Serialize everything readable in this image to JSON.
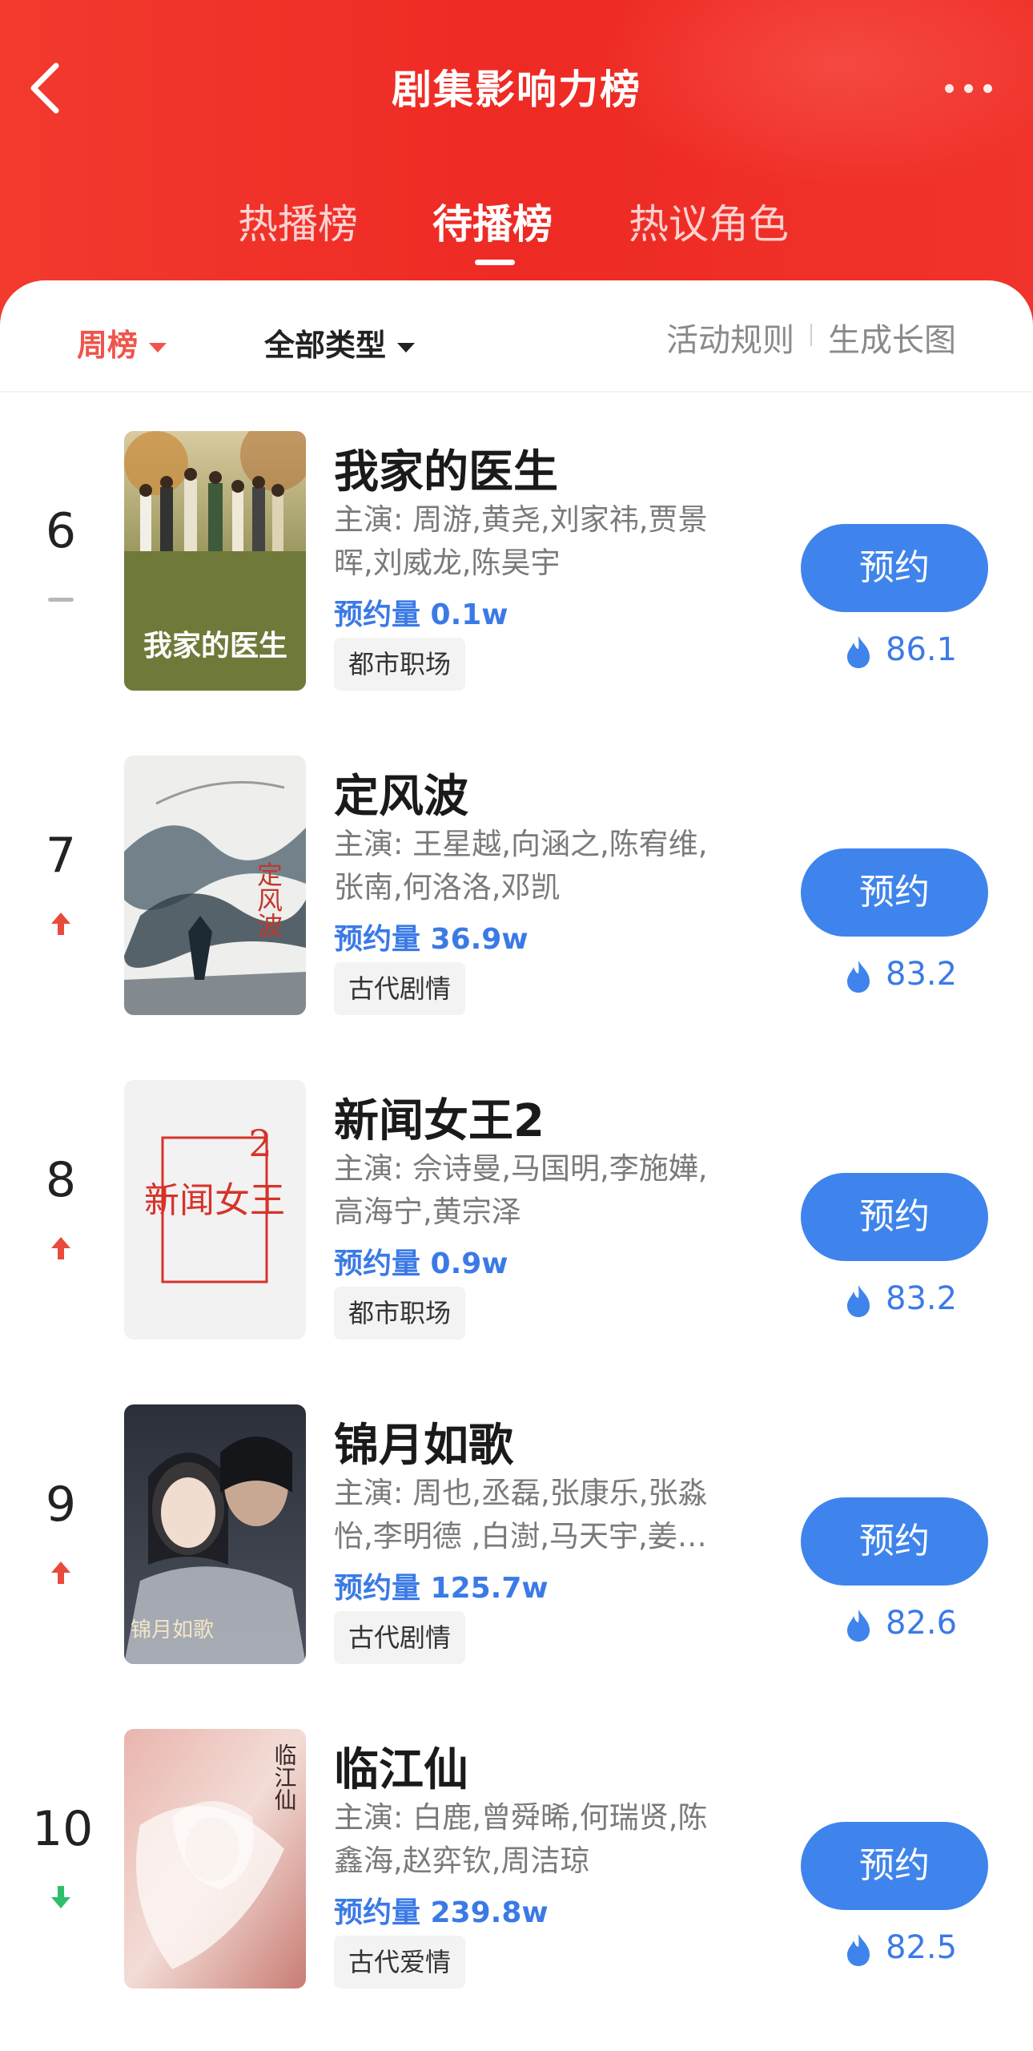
{
  "header": {
    "title": "剧集影响力榜",
    "tabs": [
      {
        "label": "热播榜",
        "active": false
      },
      {
        "label": "待播榜",
        "active": true
      },
      {
        "label": "热议角色",
        "active": false
      }
    ]
  },
  "filters": {
    "period": "周榜",
    "type": "全部类型",
    "rules": "活动规则",
    "long_image": "生成长图"
  },
  "colors": {
    "header_red": "#ef2e27",
    "accent_blue": "#3f84ec",
    "trend_up": "#e84a3c",
    "trend_down": "#2fbf6a",
    "trend_flat": "#b8b8b8"
  },
  "items": [
    {
      "rank": "6",
      "trend": "flat",
      "title": "我家的医生",
      "cast": "主演: 周游,黄尧,刘家祎,贾景晖,刘威龙,陈昊宇",
      "reserve": "预约量 0.1w",
      "genre": "都市职场",
      "button": "预约",
      "heat": "86.1",
      "poster_text": "我家的医生"
    },
    {
      "rank": "7",
      "trend": "up",
      "title": "定风波",
      "cast": "主演: 王星越,向涵之,陈宥维,张南,何洛洛,邓凯",
      "reserve": "预约量 36.9w",
      "genre": "古代剧情",
      "button": "预约",
      "heat": "83.2",
      "poster_text": "定风波"
    },
    {
      "rank": "8",
      "trend": "up",
      "title": "新闻女王2",
      "cast": "主演: 佘诗曼,马国明,李施嬅,高海宁,黄宗泽",
      "reserve": "预约量 0.9w",
      "genre": "都市职场",
      "button": "预约",
      "heat": "83.2",
      "poster_text": "新闻女王"
    },
    {
      "rank": "9",
      "trend": "up",
      "title": "锦月如歌",
      "cast": "主演: 周也,丞磊,张康乐,张淼怡,李明德 ,白澍,马天宇,姜…",
      "reserve": "预约量 125.7w",
      "genre": "古代剧情",
      "button": "预约",
      "heat": "82.6",
      "poster_text": "锦月如歌"
    },
    {
      "rank": "10",
      "trend": "down",
      "title": "临江仙",
      "cast": "主演: 白鹿,曾舜晞,何瑞贤,陈鑫海,赵弈钦,周洁琼",
      "reserve": "预约量 239.8w",
      "genre": "古代爱情",
      "button": "预约",
      "heat": "82.5",
      "poster_text": "临江仙"
    }
  ]
}
